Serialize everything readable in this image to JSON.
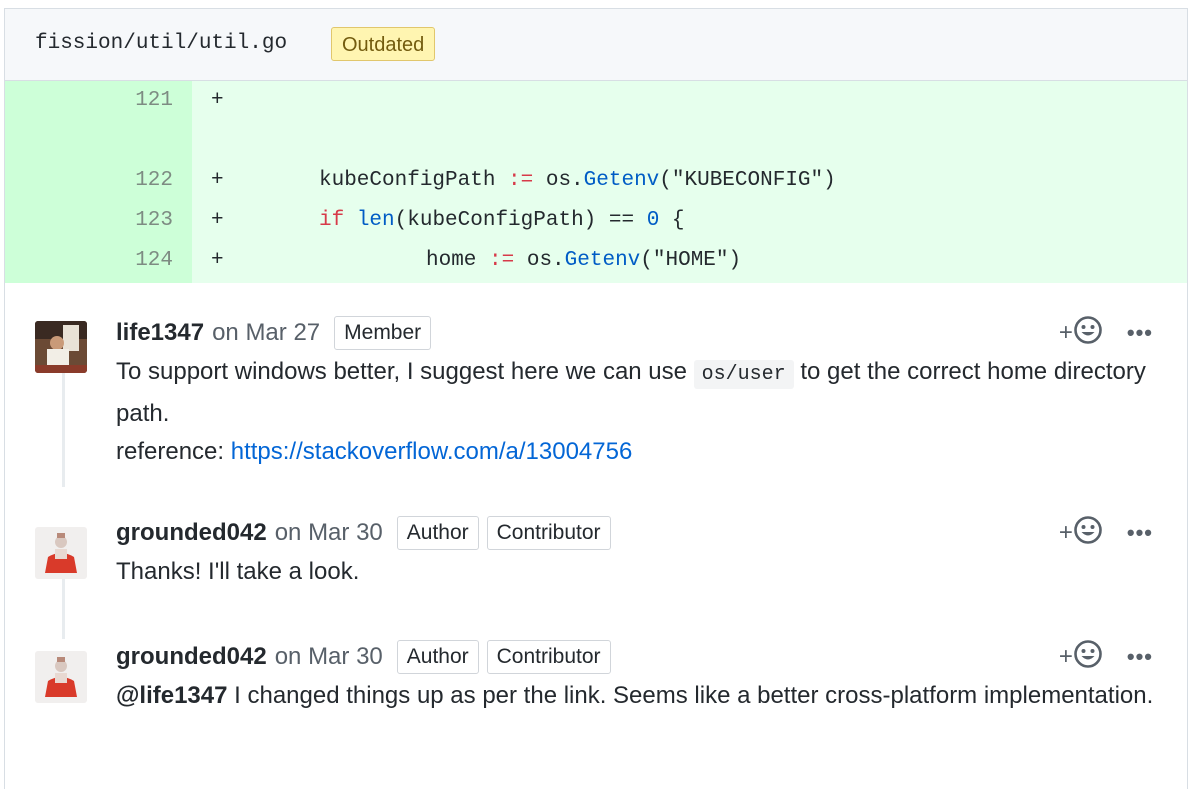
{
  "file": {
    "path": "fission/util/util.go",
    "badge": "Outdated"
  },
  "diff": {
    "lines": [
      {
        "num": "121",
        "sign": "+"
      },
      {
        "num": "122",
        "sign": "+"
      },
      {
        "num": "123",
        "sign": "+"
      },
      {
        "num": "124",
        "sign": "+"
      }
    ],
    "code": {
      "l122_var": "kubeConfigPath ",
      "l122_op": ":=",
      "l122_pkg": " os.",
      "l122_fn": "Getenv",
      "l122_arg": "(\"KUBECONFIG\")",
      "l123_kw": "if",
      "l123_fn": "len",
      "l123_mid": "(kubeConfigPath) == ",
      "l123_num": "0",
      "l123_end": " {",
      "l124_var": "home ",
      "l124_op": ":=",
      "l124_pkg": " os.",
      "l124_fn": "Getenv",
      "l124_arg": "(\"HOME\")"
    }
  },
  "comments": [
    {
      "author": "life1347",
      "date": "on Mar 27",
      "roles": [
        "Member"
      ],
      "text1": "To support windows better, I suggest here we can use ",
      "code": "os/user",
      "text2": " to get the correct home directory path.",
      "ref_label": "reference: ",
      "ref_link": "https://stackoverflow.com/a/13004756"
    },
    {
      "author": "grounded042",
      "date": "on Mar 30",
      "roles": [
        "Author",
        "Contributor"
      ],
      "text": "Thanks! I'll take a look."
    },
    {
      "author": "grounded042",
      "date": "on Mar 30",
      "roles": [
        "Author",
        "Contributor"
      ],
      "mention": "@life1347",
      "text": " I changed things up as per the link. Seems like a better cross-platform implementation."
    }
  ],
  "actions": {
    "react_plus": "+",
    "more": "•••"
  },
  "icons": {
    "reaction": "smiley-icon",
    "more": "kebab-icon"
  },
  "colors": {
    "added_bg": "#e6ffed",
    "added_gutter": "#cdffd8",
    "outdated_bg": "#fff5b1",
    "link": "#0366d6"
  }
}
